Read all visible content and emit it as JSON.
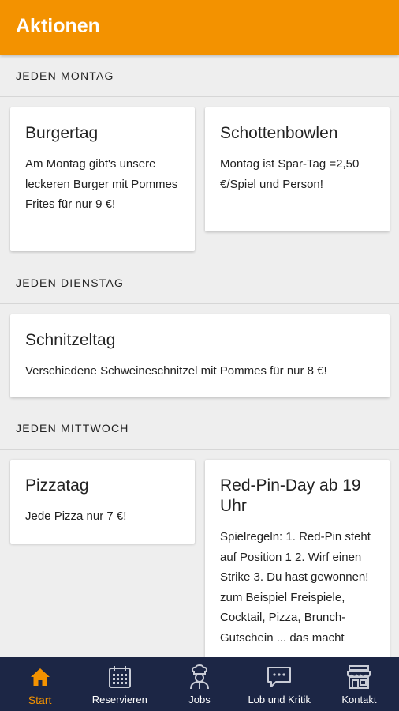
{
  "appbar": {
    "title": "Aktionen"
  },
  "sections": [
    {
      "header": "JEDEN MONTAG",
      "cards": [
        {
          "title": "Burgertag",
          "text": "Am Montag gibt's unsere leckeren Burger mit Pommes Frites für nur 9 €!"
        },
        {
          "title": "Schottenbowlen",
          "text": "Montag ist Spar-Tag =2,50 €/Spiel und Person!"
        }
      ]
    },
    {
      "header": "JEDEN DIENSTAG",
      "cards": [
        {
          "title": "Schnitzeltag",
          "text": "Verschiedene Schweineschnitzel mit Pommes für nur 8 €!"
        }
      ]
    },
    {
      "header": "JEDEN MITTWOCH",
      "cards": [
        {
          "title": "Pizzatag",
          "text": "Jede Pizza nur 7 €!"
        },
        {
          "title": "Red-Pin-Day ab 19 Uhr",
          "text": "Spielregeln: 1. Red-Pin steht auf Position 1 2. Wirf einen Strike 3. Du hast gewonnen! zum Beispiel Freispiele, Cocktail, Pizza, Brunch-Gutschein ... das macht"
        }
      ]
    }
  ],
  "bottom_nav": {
    "active_color": "#f39200",
    "background": "#1c2645",
    "items": [
      {
        "label": "Start",
        "icon": "home-icon",
        "active": true
      },
      {
        "label": "Reservieren",
        "icon": "calendar-icon",
        "active": false
      },
      {
        "label": "Jobs",
        "icon": "chef-icon",
        "active": false
      },
      {
        "label": "Lob und Kritik",
        "icon": "chat-icon",
        "active": false
      },
      {
        "label": "Kontakt",
        "icon": "store-icon",
        "active": false
      }
    ]
  }
}
